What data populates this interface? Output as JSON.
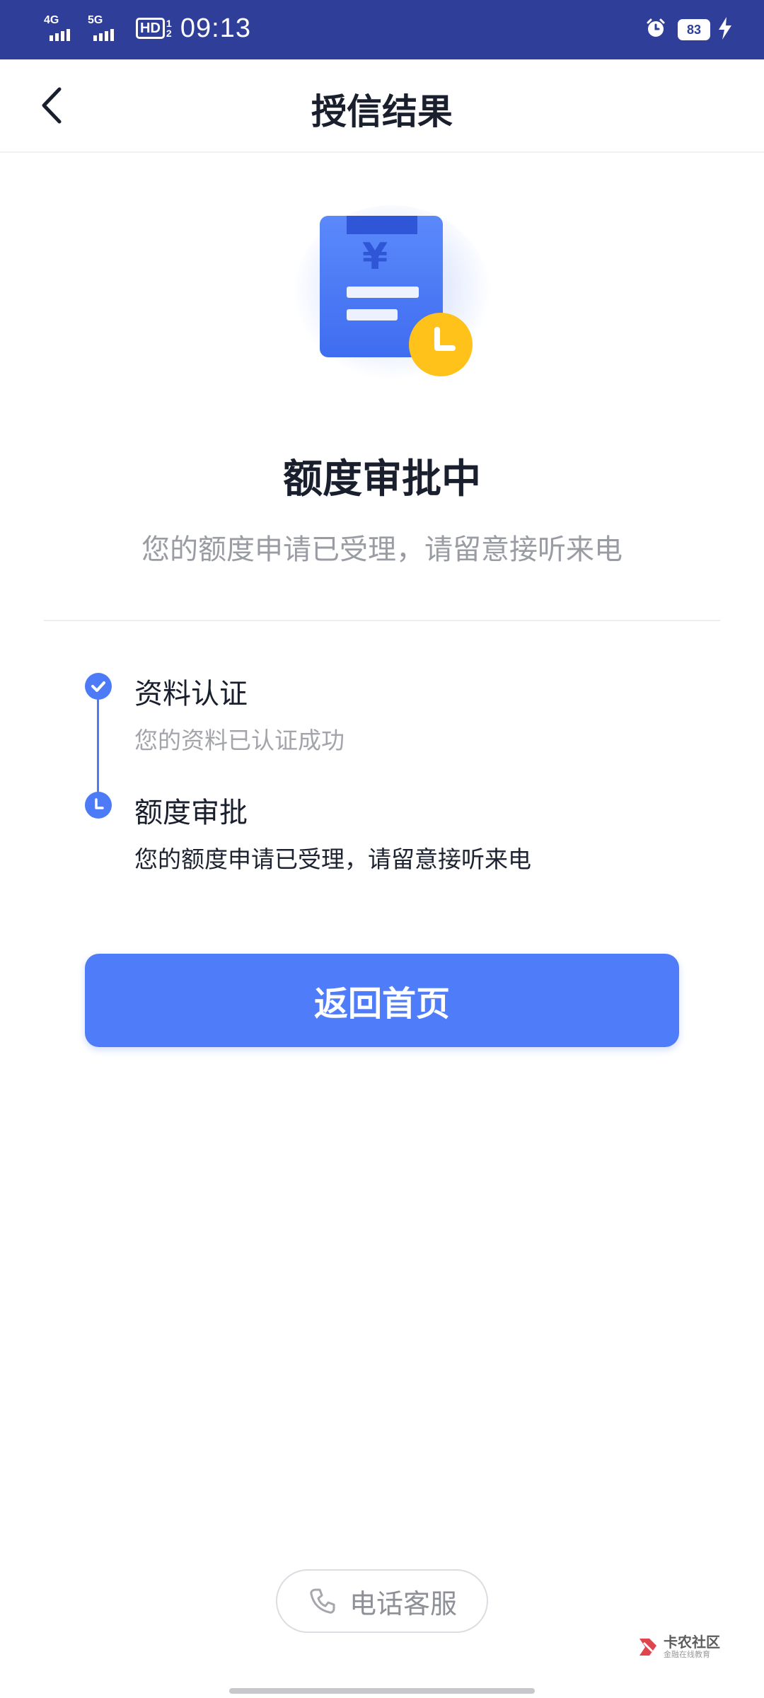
{
  "status_bar": {
    "signal1_label": "4G",
    "signal2_label": "5G",
    "hd_label": "HD",
    "hd_sub": "1 2",
    "time": "09:13",
    "battery": "83",
    "icons": [
      "alarm-icon",
      "charging-icon"
    ]
  },
  "nav": {
    "title": "授信结果",
    "back_icon": "chevron-left-icon"
  },
  "hero": {
    "icon": "document-yen-clock-icon",
    "title": "额度审批中",
    "description": "您的额度申请已受理，请留意接听来电"
  },
  "steps": [
    {
      "title": "资料认证",
      "description": "您的资料已认证成功",
      "state": "done",
      "icon": "check-icon"
    },
    {
      "title": "额度审批",
      "description": "您的额度申请已受理，请留意接听来电",
      "state": "in-progress",
      "icon": "clock-icon"
    }
  ],
  "actions": {
    "primary_label": "返回首页",
    "service_label": "电话客服",
    "service_icon": "phone-icon"
  },
  "watermark": {
    "main": "卡农社区",
    "sub": "金融在线教育"
  },
  "colors": {
    "status_bar": "#2f3f99",
    "primary": "#4f7cf9",
    "accent_yellow": "#ffc21a",
    "text_secondary": "#9a9ca3"
  }
}
